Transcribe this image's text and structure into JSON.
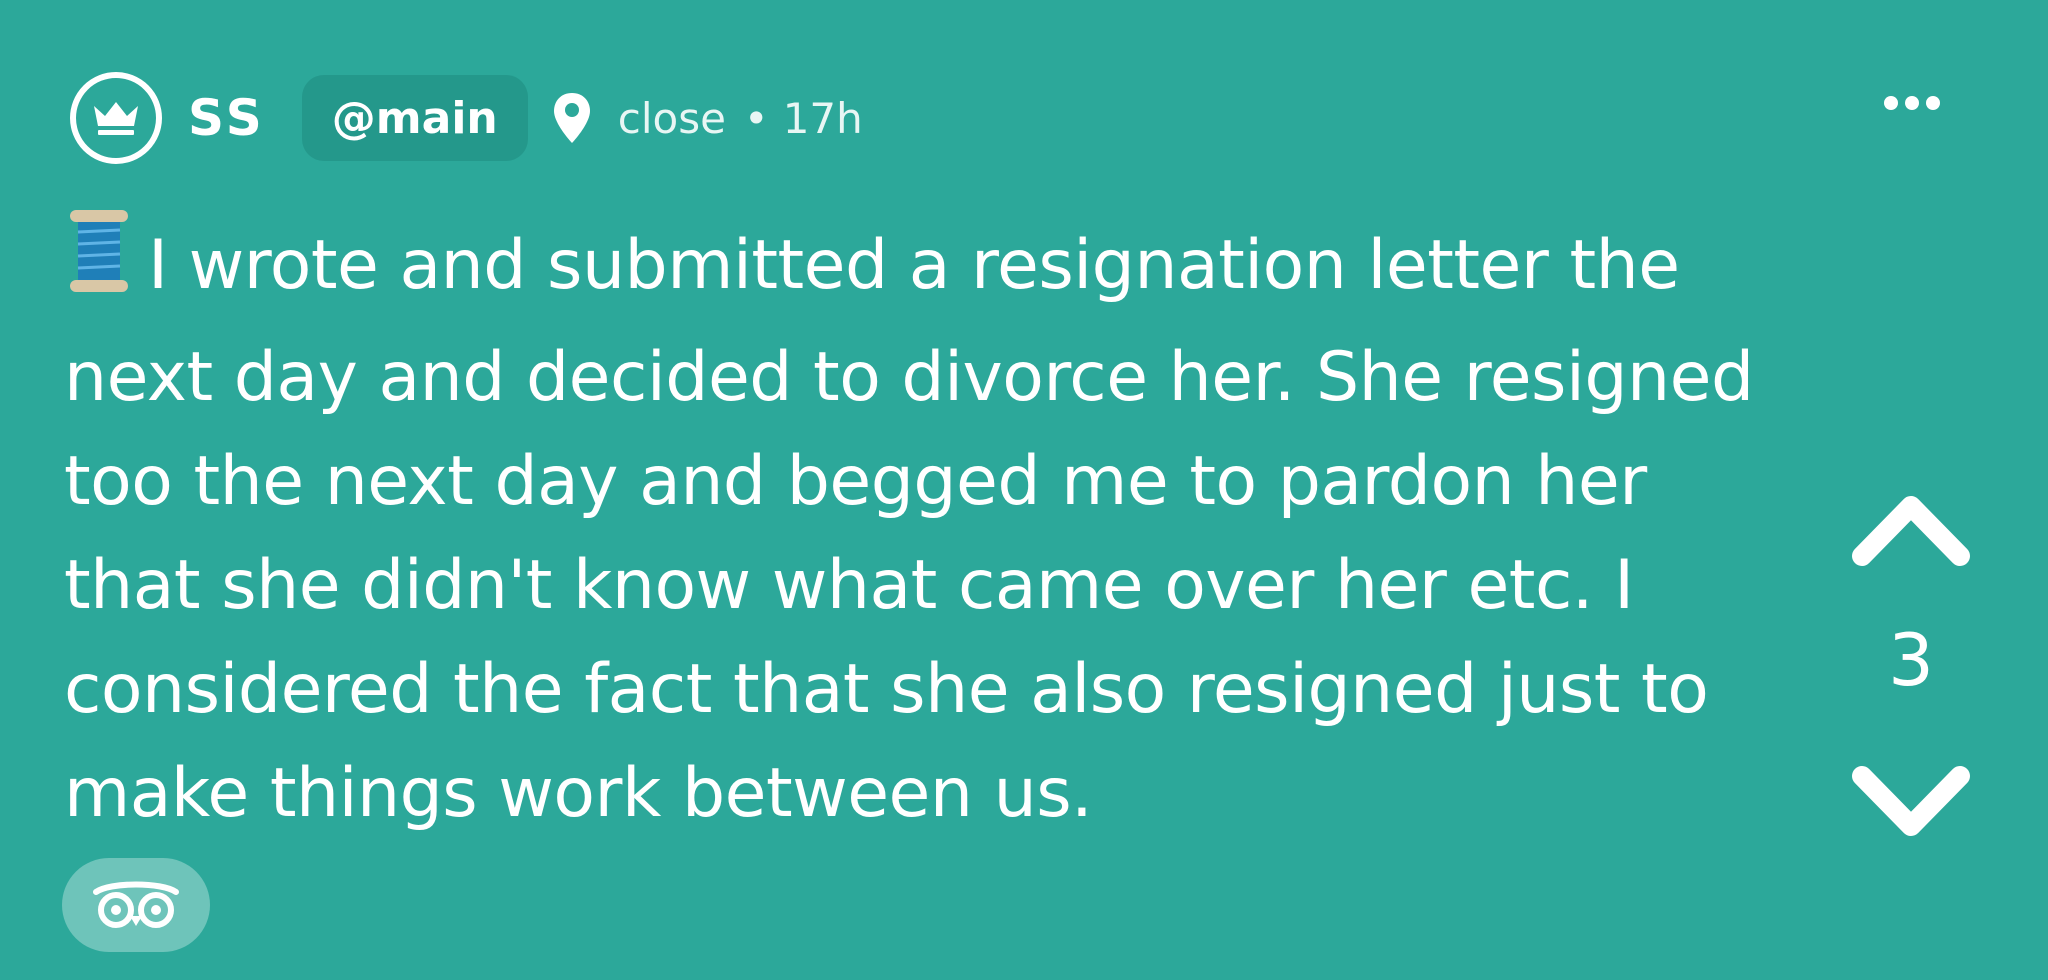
{
  "post": {
    "author": "SS",
    "community": "@main",
    "location": "close",
    "separator": "•",
    "age": "17h",
    "body_lines": [
      "I wrote and submitted a resignation letter the",
      "next day and decided to divorce her. She resigned",
      "too the next day and begged me to pardon her",
      "that she didn't know what came over her etc. I",
      "considered the fact that she also resigned just to",
      "make things work between us."
    ],
    "score": "3"
  },
  "icons": {
    "avatar": "crown-icon",
    "location": "map-pin-icon",
    "menu": "more-horizontal-icon",
    "emoji": "thread-spool-icon",
    "upvote": "chevron-up-icon",
    "downvote": "chevron-down-icon",
    "reveal": "owl-eyes-icon"
  },
  "colors": {
    "background": "#2CA89A",
    "chip": "#24988B",
    "reveal_button": "#6EC4BA",
    "text": "#FFFFFF"
  }
}
